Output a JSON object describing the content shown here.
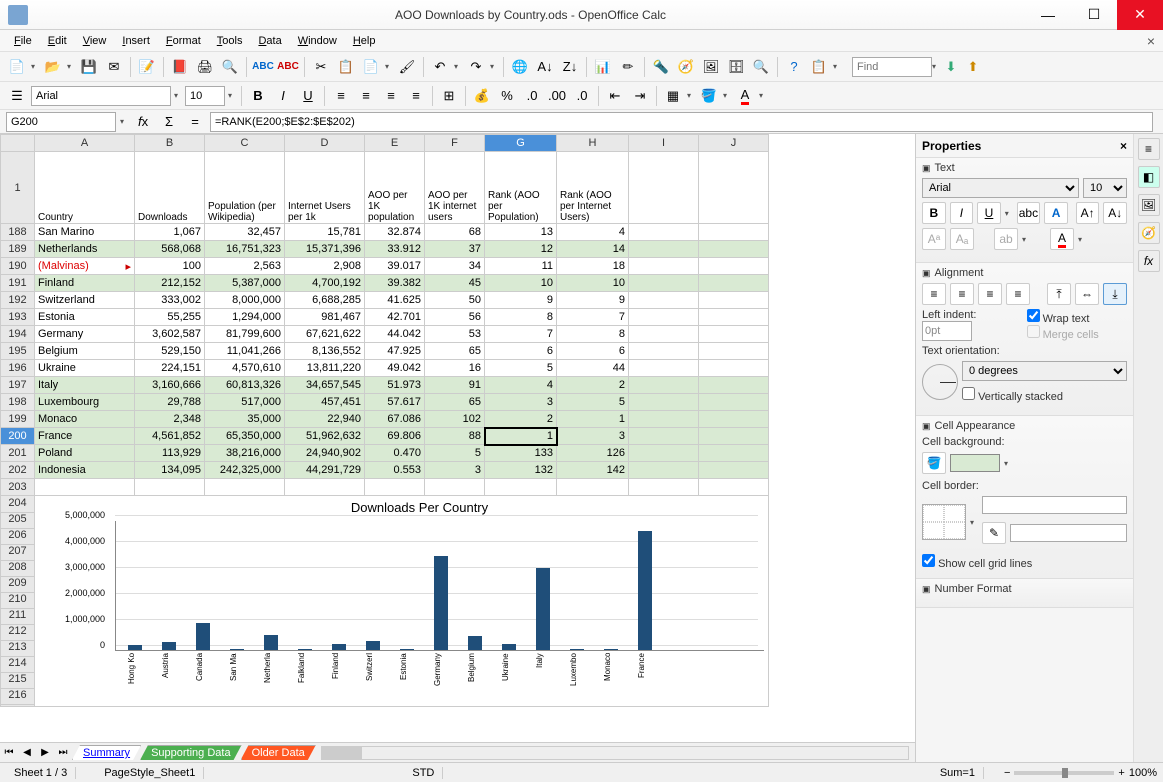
{
  "window": {
    "title": "AOO Downloads by Country.ods - OpenOffice Calc"
  },
  "menu": [
    "File",
    "Edit",
    "View",
    "Insert",
    "Format",
    "Tools",
    "Data",
    "Window",
    "Help"
  ],
  "find_placeholder": "Find",
  "font": {
    "name": "Arial",
    "size": "10"
  },
  "formula": {
    "cellref": "G200",
    "content": "=RANK(E200;$E$2:$E$202)"
  },
  "columns": [
    "A",
    "B",
    "C",
    "D",
    "E",
    "F",
    "G",
    "H",
    "I",
    "J"
  ],
  "header_row": {
    "num": "1",
    "labels": [
      "Country",
      "Downloads",
      "Population (per Wikipedia)",
      "Internet Users per 1k",
      "AOO per 1K population",
      "AOO per 1K internet users",
      "Rank (AOO per Population)",
      "Rank (AOO per Internet Users)"
    ]
  },
  "rows": [
    {
      "n": "188",
      "g": false,
      "c": [
        "San Marino",
        "1,067",
        "32,457",
        "15,781",
        "32.874",
        "68",
        "13",
        "4"
      ]
    },
    {
      "n": "189",
      "g": true,
      "c": [
        "Netherlands",
        "568,068",
        "16,751,323",
        "15,371,396",
        "33.912",
        "37",
        "12",
        "14"
      ]
    },
    {
      "n": "190",
      "g": false,
      "c": [
        "(Malvinas)",
        "100",
        "2,563",
        "2,908",
        "39.017",
        "34",
        "11",
        "18"
      ],
      "red": true,
      "mark": true
    },
    {
      "n": "191",
      "g": true,
      "c": [
        "Finland",
        "212,152",
        "5,387,000",
        "4,700,192",
        "39.382",
        "45",
        "10",
        "10"
      ]
    },
    {
      "n": "192",
      "g": false,
      "c": [
        "Switzerland",
        "333,002",
        "8,000,000",
        "6,688,285",
        "41.625",
        "50",
        "9",
        "9"
      ]
    },
    {
      "n": "193",
      "g": false,
      "c": [
        "Estonia",
        "55,255",
        "1,294,000",
        "981,467",
        "42.701",
        "56",
        "8",
        "7"
      ]
    },
    {
      "n": "194",
      "g": false,
      "c": [
        "Germany",
        "3,602,587",
        "81,799,600",
        "67,621,622",
        "44.042",
        "53",
        "7",
        "8"
      ]
    },
    {
      "n": "195",
      "g": false,
      "c": [
        "Belgium",
        "529,150",
        "11,041,266",
        "8,136,552",
        "47.925",
        "65",
        "6",
        "6"
      ]
    },
    {
      "n": "196",
      "g": false,
      "c": [
        "Ukraine",
        "224,151",
        "4,570,610",
        "13,811,220",
        "49.042",
        "16",
        "5",
        "44"
      ]
    },
    {
      "n": "197",
      "g": true,
      "c": [
        "Italy",
        "3,160,666",
        "60,813,326",
        "34,657,545",
        "51.973",
        "91",
        "4",
        "2"
      ]
    },
    {
      "n": "198",
      "g": true,
      "c": [
        "Luxembourg",
        "29,788",
        "517,000",
        "457,451",
        "57.617",
        "65",
        "3",
        "5"
      ]
    },
    {
      "n": "199",
      "g": true,
      "c": [
        "Monaco",
        "2,348",
        "35,000",
        "22,940",
        "67.086",
        "102",
        "2",
        "1"
      ]
    },
    {
      "n": "200",
      "g": true,
      "c": [
        "France",
        "4,561,852",
        "65,350,000",
        "51,962,632",
        "69.806",
        "88",
        "1",
        "3"
      ],
      "sel": 6
    },
    {
      "n": "201",
      "g": true,
      "c": [
        "Poland",
        "113,929",
        "38,216,000",
        "24,940,902",
        "0.470",
        "5",
        "133",
        "126"
      ]
    },
    {
      "n": "202",
      "g": true,
      "c": [
        "Indonesia",
        "134,095",
        "242,325,000",
        "44,291,729",
        "0.553",
        "3",
        "132",
        "142"
      ]
    }
  ],
  "empty_rows": [
    "203"
  ],
  "chart_rows": [
    "204",
    "205",
    "206",
    "207",
    "208",
    "209",
    "210",
    "211",
    "212",
    "213",
    "214",
    "215",
    "216"
  ],
  "chart_data": {
    "type": "bar",
    "title": "Downloads Per Country",
    "ylabel": "",
    "ylim": [
      0,
      5000000
    ],
    "yticks": [
      "0",
      "1,000,000",
      "2,000,000",
      "3,000,000",
      "4,000,000",
      "5,000,000"
    ],
    "categories": [
      "Hong Ko",
      "Austria",
      "Canada",
      "San Ma",
      "Netherla",
      "Falkland",
      "Finland",
      "Switzerl",
      "Estonia",
      "Germany",
      "Belgium",
      "Ukraine",
      "Italy",
      "Luxembo",
      "Monaco",
      "France"
    ],
    "values": [
      180000,
      300000,
      1050000,
      1067,
      568068,
      100,
      212152,
      333002,
      55255,
      3602587,
      529150,
      224151,
      3160666,
      29788,
      2348,
      4561852
    ]
  },
  "tabs": {
    "list": [
      "Summary",
      "Supporting Data",
      "Older Data"
    ],
    "active": 0
  },
  "status": {
    "sheet": "Sheet 1 / 3",
    "style": "PageStyle_Sheet1",
    "mode": "STD",
    "sum": "Sum=1",
    "zoom": "100%"
  },
  "sidebar": {
    "title": "Properties",
    "text": {
      "title": "Text",
      "font": "Arial",
      "size": "10"
    },
    "align": {
      "title": "Alignment",
      "indent_label": "Left indent:",
      "indent": "0pt",
      "wrap_label": "Wrap text",
      "wrap": true,
      "merge_label": "Merge cells",
      "merge": false,
      "orient_label": "Text orientation:",
      "degrees": "0 degrees",
      "vstack_label": "Vertically stacked",
      "vstack": false
    },
    "cellapp": {
      "title": "Cell Appearance",
      "bg_label": "Cell background:",
      "border_label": "Cell border:",
      "grid_label": "Show cell grid lines",
      "grid": true
    },
    "numfmt": {
      "title": "Number Format"
    }
  }
}
